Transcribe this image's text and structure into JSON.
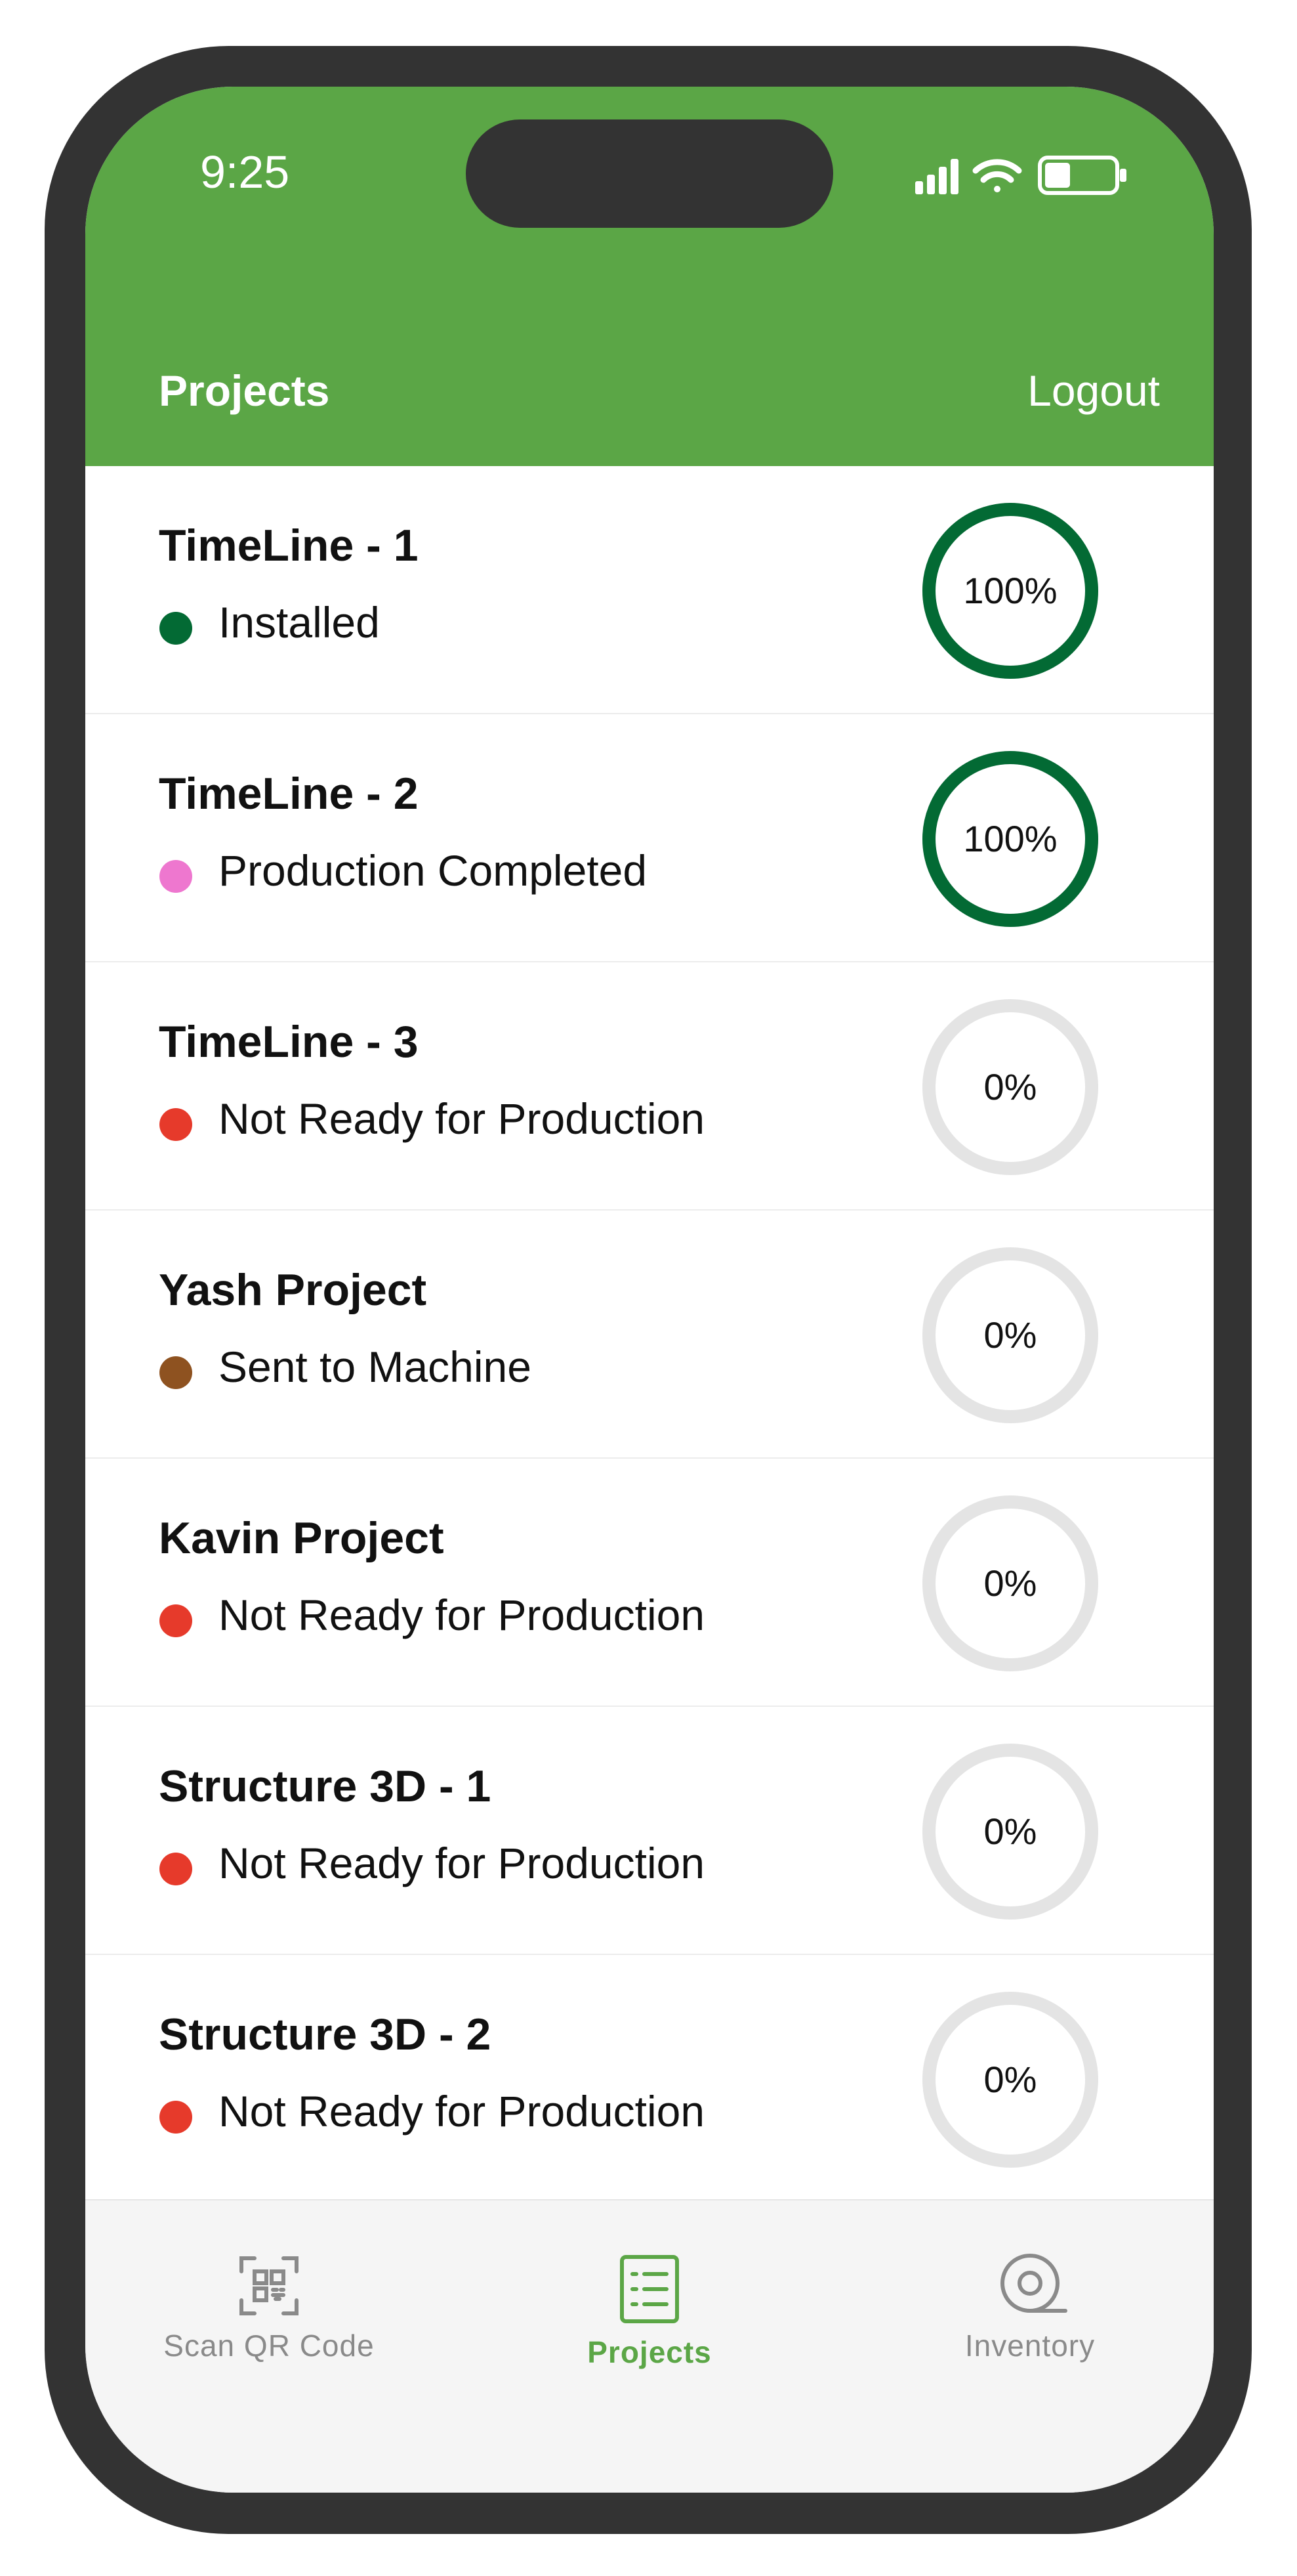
{
  "status_bar": {
    "time": "9:25"
  },
  "header": {
    "title": "Projects",
    "logout_label": "Logout",
    "color": "#5ba646"
  },
  "projects": [
    {
      "name": "TimeLine - 1",
      "status": "Installed",
      "status_color": "#036a34",
      "progress": 100,
      "progress_label": "100%"
    },
    {
      "name": "TimeLine - 2",
      "status": "Production Completed",
      "status_color": "#ee77cf",
      "progress": 100,
      "progress_label": "100%"
    },
    {
      "name": "TimeLine - 3",
      "status": "Not Ready for Production",
      "status_color": "#e63a2b",
      "progress": 0,
      "progress_label": "0%"
    },
    {
      "name": "Yash Project",
      "status": "Sent to Machine",
      "status_color": "#8e5220",
      "progress": 0,
      "progress_label": "0%"
    },
    {
      "name": "Kavin Project",
      "status": "Not Ready for Production",
      "status_color": "#e63a2b",
      "progress": 0,
      "progress_label": "0%"
    },
    {
      "name": "Structure 3D - 1",
      "status": "Not Ready for Production",
      "status_color": "#e63a2b",
      "progress": 0,
      "progress_label": "0%"
    },
    {
      "name": "Structure 3D - 2",
      "status": "Not Ready for Production",
      "status_color": "#e63a2b",
      "progress": 0,
      "progress_label": "0%"
    }
  ],
  "ring_colors": {
    "complete": "#036a34",
    "track": "#e4e4e4"
  },
  "tabbar": {
    "tabs": [
      {
        "label": "Scan QR Code",
        "icon": "qr-scan-icon",
        "active": false
      },
      {
        "label": "Projects",
        "icon": "list-icon",
        "active": true
      },
      {
        "label": "Inventory",
        "icon": "roll-icon",
        "active": false
      }
    ],
    "active_color": "#5ba646",
    "inactive_color": "#8a8a8a"
  }
}
